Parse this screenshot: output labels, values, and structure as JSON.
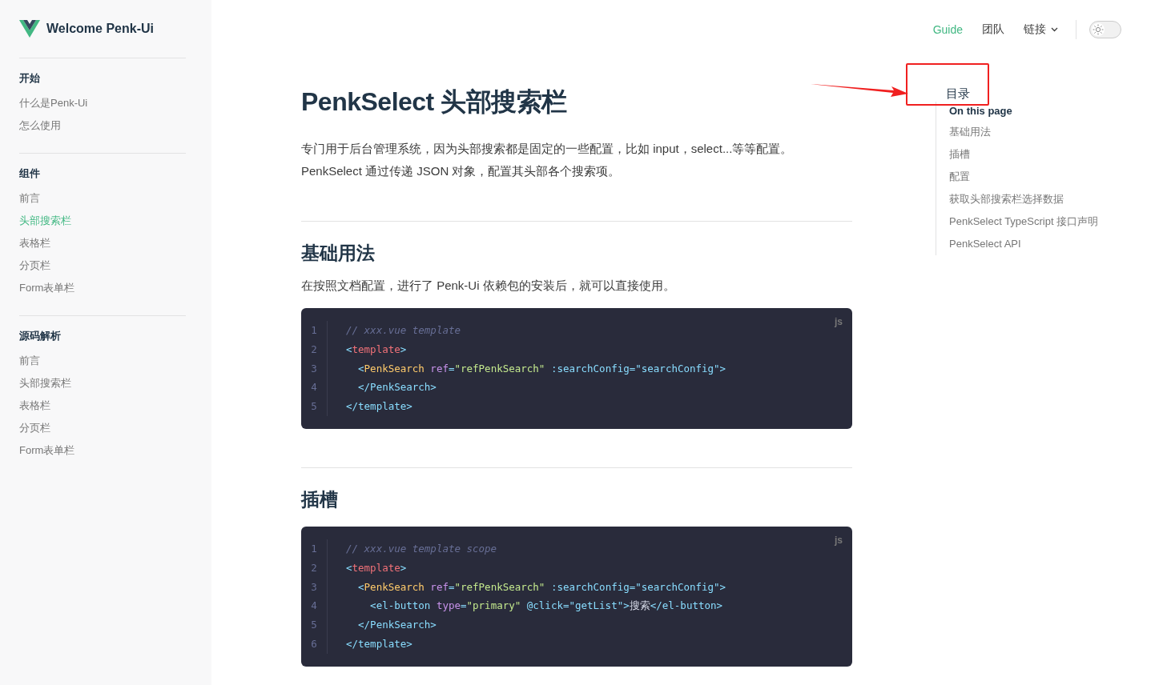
{
  "brand": {
    "title": "Welcome Penk-Ui"
  },
  "sidebar": {
    "groups": [
      {
        "title": "开始",
        "items": [
          {
            "label": "什么是Penk-Ui",
            "selected": false
          },
          {
            "label": "怎么使用",
            "selected": false
          }
        ]
      },
      {
        "title": "组件",
        "items": [
          {
            "label": "前言",
            "selected": false
          },
          {
            "label": "头部搜索栏",
            "selected": true
          },
          {
            "label": "表格栏",
            "selected": false
          },
          {
            "label": "分页栏",
            "selected": false
          },
          {
            "label": "Form表单栏",
            "selected": false
          }
        ]
      },
      {
        "title": "源码解析",
        "items": [
          {
            "label": "前言",
            "selected": false
          },
          {
            "label": "头部搜索栏",
            "selected": false
          },
          {
            "label": "表格栏",
            "selected": false
          },
          {
            "label": "分页栏",
            "selected": false
          },
          {
            "label": "Form表单栏",
            "selected": false
          }
        ]
      }
    ]
  },
  "nav": {
    "links": [
      {
        "label": "Guide",
        "selected": true,
        "dropdown": false
      },
      {
        "label": "团队",
        "selected": false,
        "dropdown": false
      },
      {
        "label": "链接",
        "selected": false,
        "dropdown": true
      }
    ],
    "dark_mode": {
      "on": false
    }
  },
  "page": {
    "title": "PenkSelect 头部搜索栏",
    "intro": [
      "专门用于后台管理系统，因为头部搜索都是固定的一些配置，比如 input，select...等等配置。",
      "PenkSelect 通过传递 JSON 对象，配置其头部各个搜索项。"
    ],
    "sections": [
      {
        "heading": "基础用法",
        "text": "在按照文档配置，进行了 Penk-Ui 依赖包的安装后，就可以直接使用。",
        "code": {
          "lang": "js",
          "lines": [
            {
              "number": "1",
              "tokens": [
                {
                  "kind": "comment",
                  "text": "// xxx.vue template"
                }
              ]
            },
            {
              "number": "2",
              "tokens": [
                {
                  "kind": "punct",
                  "text": "<"
                },
                {
                  "kind": "tag",
                  "text": "template"
                },
                {
                  "kind": "punct",
                  "text": ">"
                }
              ]
            },
            {
              "number": "3",
              "tokens": [
                {
                  "kind": "punct",
                  "text": "  <"
                },
                {
                  "kind": "component",
                  "text": "PenkSearch"
                },
                {
                  "kind": "attr",
                  "text": " ref"
                },
                {
                  "kind": "punct",
                  "text": "="
                },
                {
                  "kind": "string",
                  "text": "\"refPenkSearch\""
                },
                {
                  "kind": "punct",
                  "text": " :searchConfig=\"searchConfig\">"
                }
              ]
            },
            {
              "number": "4",
              "tokens": [
                {
                  "kind": "punct",
                  "text": "  </PenkSearch>"
                }
              ]
            },
            {
              "number": "5",
              "tokens": [
                {
                  "kind": "punct",
                  "text": "</template>"
                }
              ]
            }
          ]
        }
      },
      {
        "heading": "插槽",
        "code": {
          "lang": "js",
          "lines": [
            {
              "number": "1",
              "tokens": [
                {
                  "kind": "comment",
                  "text": "// xxx.vue template scope"
                }
              ]
            },
            {
              "number": "2",
              "tokens": [
                {
                  "kind": "punct",
                  "text": "<"
                },
                {
                  "kind": "tag",
                  "text": "template"
                },
                {
                  "kind": "punct",
                  "text": ">"
                }
              ]
            },
            {
              "number": "3",
              "tokens": [
                {
                  "kind": "punct",
                  "text": "  <"
                },
                {
                  "kind": "component",
                  "text": "PenkSearch"
                },
                {
                  "kind": "attr",
                  "text": " ref"
                },
                {
                  "kind": "punct",
                  "text": "="
                },
                {
                  "kind": "string",
                  "text": "\"refPenkSearch\""
                },
                {
                  "kind": "punct",
                  "text": " :searchConfig=\"searchConfig\">"
                }
              ]
            },
            {
              "number": "4",
              "tokens": [
                {
                  "kind": "punct",
                  "text": "    <el-button"
                },
                {
                  "kind": "attr",
                  "text": " type"
                },
                {
                  "kind": "punct",
                  "text": "="
                },
                {
                  "kind": "string",
                  "text": "\"primary\""
                },
                {
                  "kind": "punct",
                  "text": " @click=\"getList\">"
                },
                {
                  "kind": "plain",
                  "text": "搜索"
                },
                {
                  "kind": "punct",
                  "text": "</el-button>"
                }
              ]
            },
            {
              "number": "5",
              "tokens": [
                {
                  "kind": "punct",
                  "text": "  </PenkSearch>"
                }
              ]
            },
            {
              "number": "6",
              "tokens": [
                {
                  "kind": "punct",
                  "text": "</template>"
                }
              ]
            }
          ]
        }
      }
    ]
  },
  "toc": {
    "annotation": "目录",
    "title": "On this page",
    "items": [
      {
        "label": "基础用法"
      },
      {
        "label": "插槽"
      },
      {
        "label": "配置"
      },
      {
        "label": "获取头部搜索栏选择数据"
      },
      {
        "label": "PenkSelect TypeScript 接口声明"
      },
      {
        "label": "PenkSelect API"
      }
    ]
  }
}
